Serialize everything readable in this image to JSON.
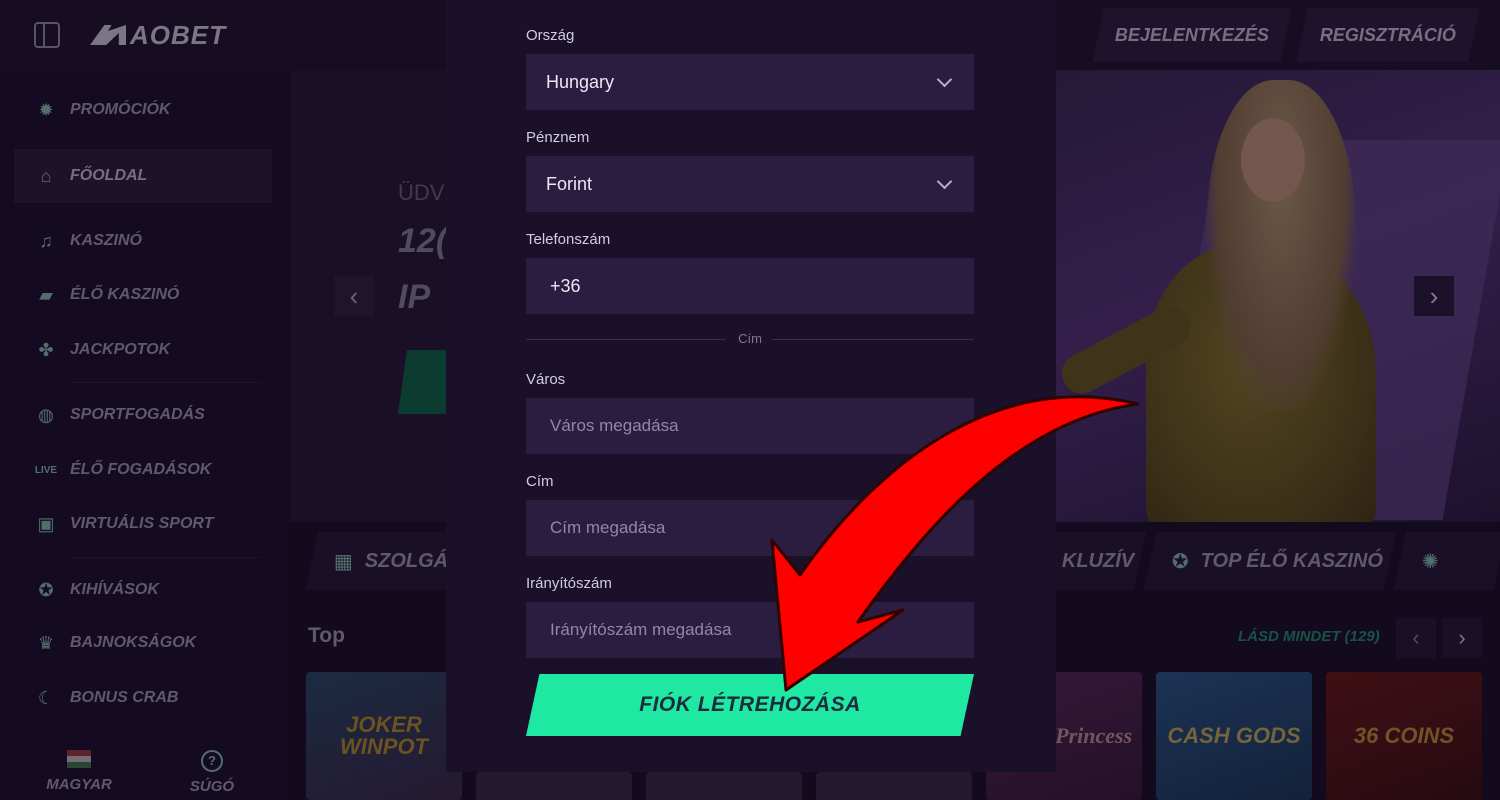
{
  "header": {
    "logo_text": "AOBET",
    "login_label": "BEJELENTKEZÉS",
    "register_label": "REGISZTRÁCIÓ"
  },
  "sidebar": {
    "items": [
      {
        "label": "PROMÓCIÓK",
        "icon": "promo-icon"
      },
      {
        "label": "FŐOLDAL",
        "icon": "home-icon"
      },
      {
        "label": "KASZINÓ",
        "icon": "music-note-icon"
      },
      {
        "label": "ÉLŐ KASZINÓ",
        "icon": "cards-icon"
      },
      {
        "label": "JACKPOTOK",
        "icon": "clover-icon"
      },
      {
        "label": "SPORTFOGADÁS",
        "icon": "ball-icon"
      },
      {
        "label": "ÉLŐ FOGADÁSOK",
        "icon": "live-icon"
      },
      {
        "label": "VIRTUÁLIS SPORT",
        "icon": "monitor-icon"
      },
      {
        "label": "KIHÍVÁSOK",
        "icon": "medal-icon"
      },
      {
        "label": "BAJNOKSÁGOK",
        "icon": "trophy-icon"
      },
      {
        "label": "BONUS CRAB",
        "icon": "crab-icon"
      }
    ],
    "language_label": "MAGYAR",
    "help_label": "SÚGÓ",
    "help_glyph": "?"
  },
  "hero": {
    "line1": "ÜDV",
    "line2": "12(",
    "line3": "IP"
  },
  "categories": {
    "cat1": "SZOLGÁ",
    "cat2": "KLUZÍV",
    "cat3": "TOP ÉLŐ KASZINÓ"
  },
  "games_section": {
    "title": "Top",
    "see_all": "LÁSD MINDET (129)",
    "tiles": [
      "JOKER WINPOT",
      "Moon Princess",
      "CASH GODS",
      "36 COINS"
    ]
  },
  "form": {
    "country": {
      "label": "Ország",
      "value": "Hungary"
    },
    "currency": {
      "label": "Pénznem",
      "value": "Forint"
    },
    "phone": {
      "label": "Telefonszám",
      "value": "+36"
    },
    "address_divider": "Cím",
    "city": {
      "label": "Város",
      "placeholder": "Város megadása"
    },
    "address": {
      "label": "Cím",
      "placeholder": "Cím megadása"
    },
    "zip": {
      "label": "Irányítószám",
      "placeholder": "Irányítószám megadása"
    },
    "submit_label": "FIÓK LÉTREHOZÁSA"
  },
  "colors": {
    "accent": "#1ee8a2",
    "annotation_arrow": "#ff0000",
    "modal_bg": "#1a102a",
    "field_bg": "#2a1d40"
  }
}
